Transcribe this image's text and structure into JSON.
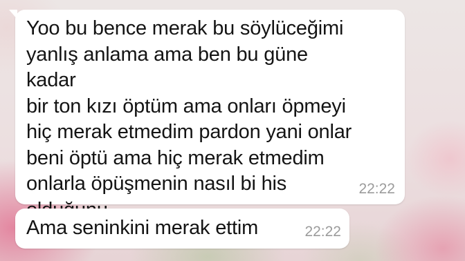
{
  "chat": {
    "messages": [
      {
        "text": "Yoo bu bence merak bu söylüceğimi\nyanlış anlama ama ben bu güne kadar\nbir ton kızı öptüm ama onları öpmeyi\nhiç merak etmedim pardon yani onlar\nbeni öptü ama hiç merak etmedim\nonlarla öpüşmenin nasıl bi his\nolduğunu",
        "time": "22:22"
      },
      {
        "text": "Ama seninkini merak ettim",
        "time": "22:22"
      }
    ]
  }
}
